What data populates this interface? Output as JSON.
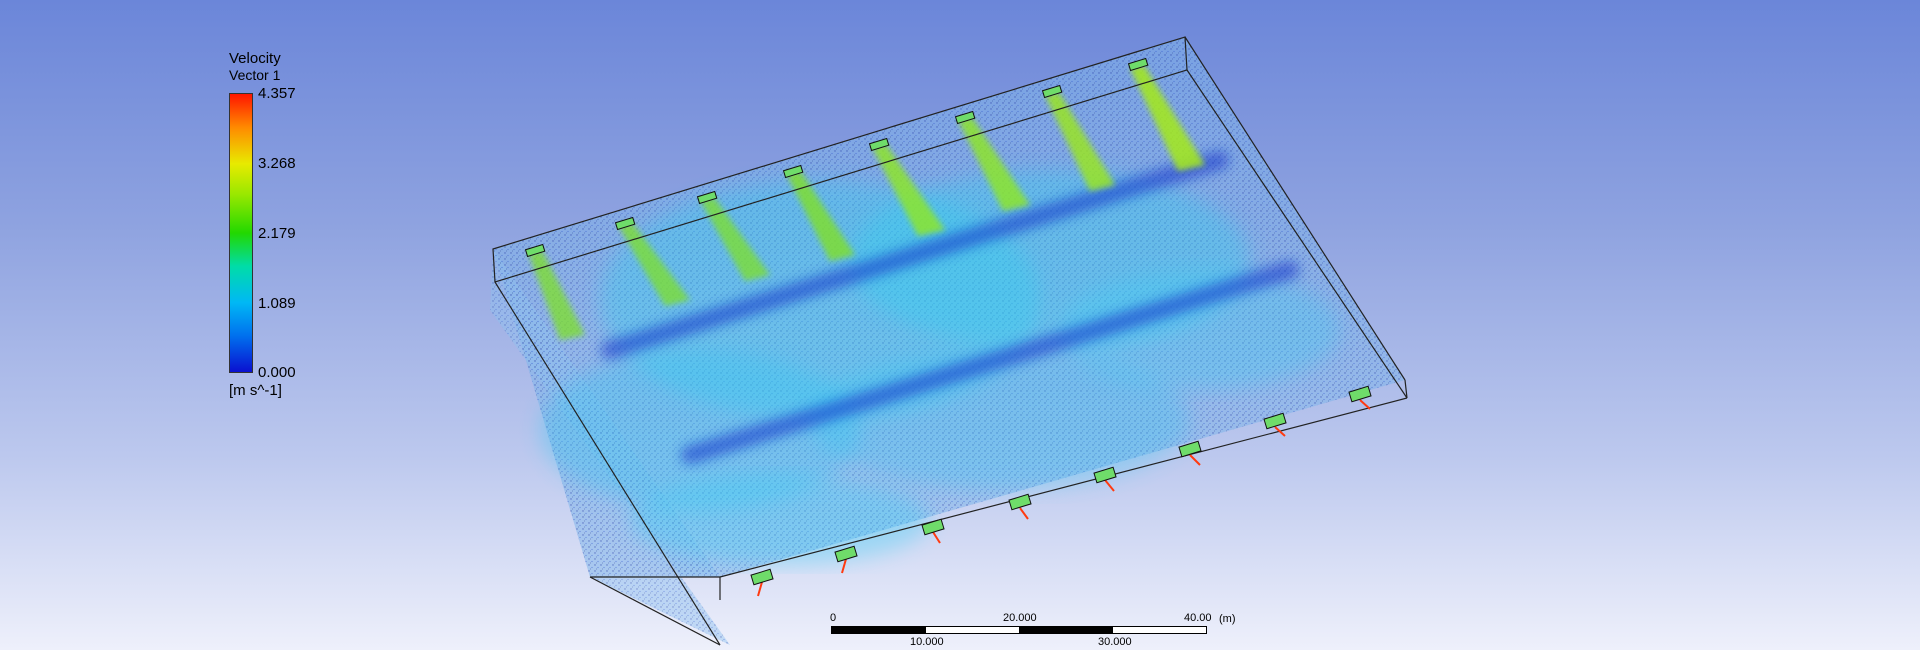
{
  "legend": {
    "title": "Velocity",
    "subtitle": "Vector 1",
    "ticks": [
      "4.357",
      "3.268",
      "2.179",
      "1.089",
      "0.000"
    ],
    "units": "[m s^-1]",
    "colors": [
      "#ff1500",
      "#e8ea00",
      "#22d800",
      "#00b8f5",
      "#0a10d0"
    ]
  },
  "scale_bar": {
    "top_labels": [
      "0",
      "20.000",
      "40.00",
      "(m)"
    ],
    "bottom_labels": [
      "10.000",
      "30.000"
    ]
  },
  "background": {
    "top": "#6b86d9",
    "bottom": "#eef0fb"
  }
}
